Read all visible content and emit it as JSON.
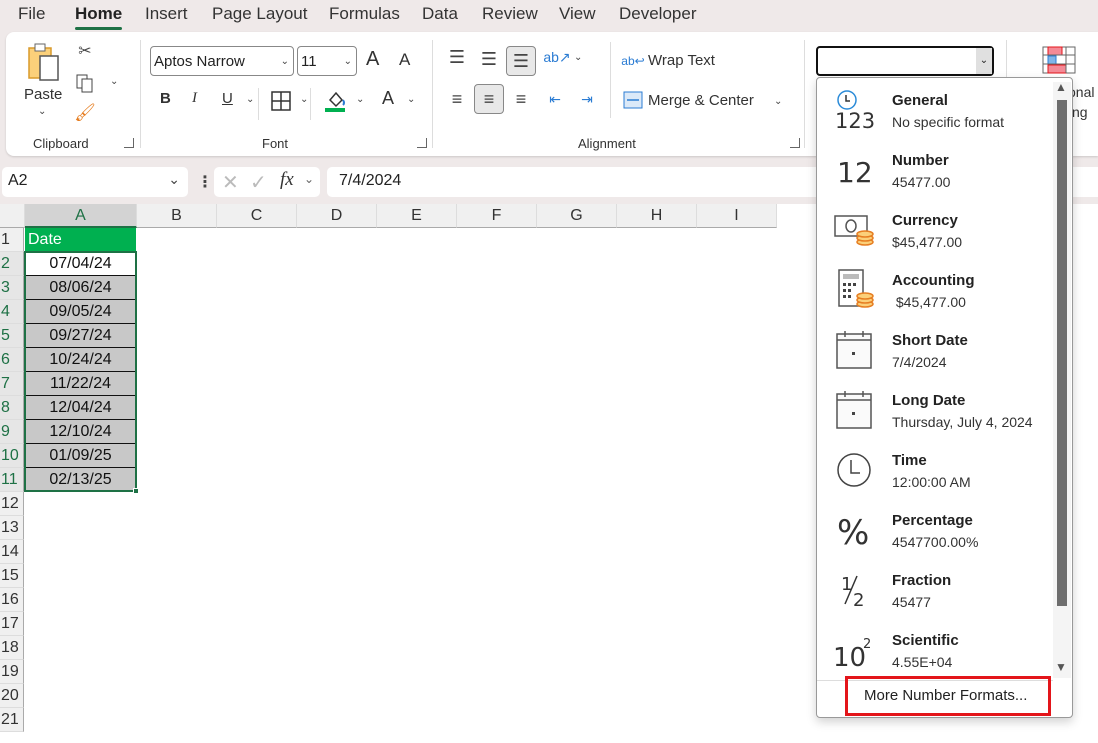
{
  "menu": {
    "tabs": [
      "File",
      "Home",
      "Insert",
      "Page Layout",
      "Formulas",
      "Data",
      "Review",
      "View",
      "Developer"
    ],
    "active": "Home"
  },
  "ribbon": {
    "clipboard": {
      "paste_label": "Paste",
      "group_label": "Clipboard"
    },
    "font": {
      "font_name": "Aptos Narrow",
      "font_size": "11",
      "group_label": "Font",
      "bold": "B",
      "italic": "I",
      "underline": "U",
      "grow": "A",
      "shrink": "A",
      "font_color": "A"
    },
    "alignment": {
      "wrap_text": "Wrap Text",
      "merge_center": "Merge & Center",
      "group_label": "Alignment"
    },
    "number": {
      "format_value": ""
    },
    "styles": {
      "conditional_partial_1": "onal",
      "conditional_partial_2": "ng"
    }
  },
  "formula_bar": {
    "name_box": "A2",
    "fx": "fx",
    "value": "7/4/2024"
  },
  "sheet": {
    "columns": [
      "A",
      "B",
      "C",
      "D",
      "E",
      "F",
      "G",
      "H",
      "I"
    ],
    "rows": [
      "1",
      "2",
      "3",
      "4",
      "5",
      "6",
      "7",
      "8",
      "9",
      "10",
      "11",
      "12",
      "13",
      "14",
      "15",
      "16",
      "17",
      "18",
      "19",
      "20",
      "21"
    ],
    "header": "Date",
    "dates": [
      "07/04/24",
      "08/06/24",
      "09/05/24",
      "09/27/24",
      "10/24/24",
      "11/22/24",
      "12/04/24",
      "12/10/24",
      "01/09/25",
      "02/13/25"
    ],
    "active_cell": "A2"
  },
  "number_format_dropdown": {
    "items": [
      {
        "title": "General",
        "sub": "No specific format",
        "icon": "general-icon"
      },
      {
        "title": "Number",
        "sub": "45477.00",
        "icon": "number-icon"
      },
      {
        "title": "Currency",
        "sub": "$45,477.00",
        "icon": "currency-icon"
      },
      {
        "title": "Accounting",
        "sub": " $45,477.00",
        "icon": "accounting-icon"
      },
      {
        "title": "Short Date",
        "sub": "7/4/2024",
        "icon": "calendar-icon"
      },
      {
        "title": "Long Date",
        "sub": "Thursday, July 4, 2024",
        "icon": "calendar-icon"
      },
      {
        "title": "Time",
        "sub": "12:00:00 AM",
        "icon": "clock-icon"
      },
      {
        "title": "Percentage",
        "sub": "4547700.00%",
        "icon": "percent-icon"
      },
      {
        "title": "Fraction",
        "sub": "45477",
        "icon": "fraction-icon"
      },
      {
        "title": "Scientific",
        "sub": "4.55E+04",
        "icon": "scientific-icon"
      }
    ],
    "more_label": "More Number Formats...",
    "highlight_color": "#e3151a"
  },
  "colors": {
    "accent": "#1e7145",
    "header_fill": "#00b050",
    "selection_fill": "#c8c8c8"
  }
}
